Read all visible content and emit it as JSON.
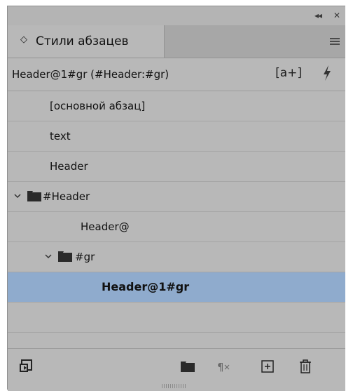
{
  "window": {
    "collapse_glyph": "◂◂",
    "close_glyph": "✕"
  },
  "panel": {
    "tab_arrows": "◇",
    "tab_label": "Стили абзацев",
    "current_style": "Header@1#gr (#Header:#gr)",
    "new_style_from_selection_label": "[a+]"
  },
  "styles": {
    "basic": "[основной абзац]",
    "text": "text",
    "header": "Header",
    "group_header": "#Header",
    "header_at": "Header@",
    "group_gr": "#gr",
    "selected": "Header@1#gr"
  },
  "icons": {
    "collapse": "double-chevron-left-icon",
    "close": "close-icon",
    "panel_menu": "hamburger-menu-icon",
    "new_style_from_selection": "new-style-from-selection-icon",
    "quick_apply": "lightning-bolt-icon",
    "folder": "folder-icon",
    "chevron": "chevron-down-icon",
    "load_styles": "load-styles-icon",
    "new_group": "new-group-folder-icon",
    "clear_overrides": "clear-overrides-icon",
    "new_style": "new-style-icon",
    "delete": "trash-icon"
  },
  "colors": {
    "panel_bg": "#b8b8b8",
    "selected_row": "#8fabcd",
    "folder": "#2a2a2a"
  }
}
